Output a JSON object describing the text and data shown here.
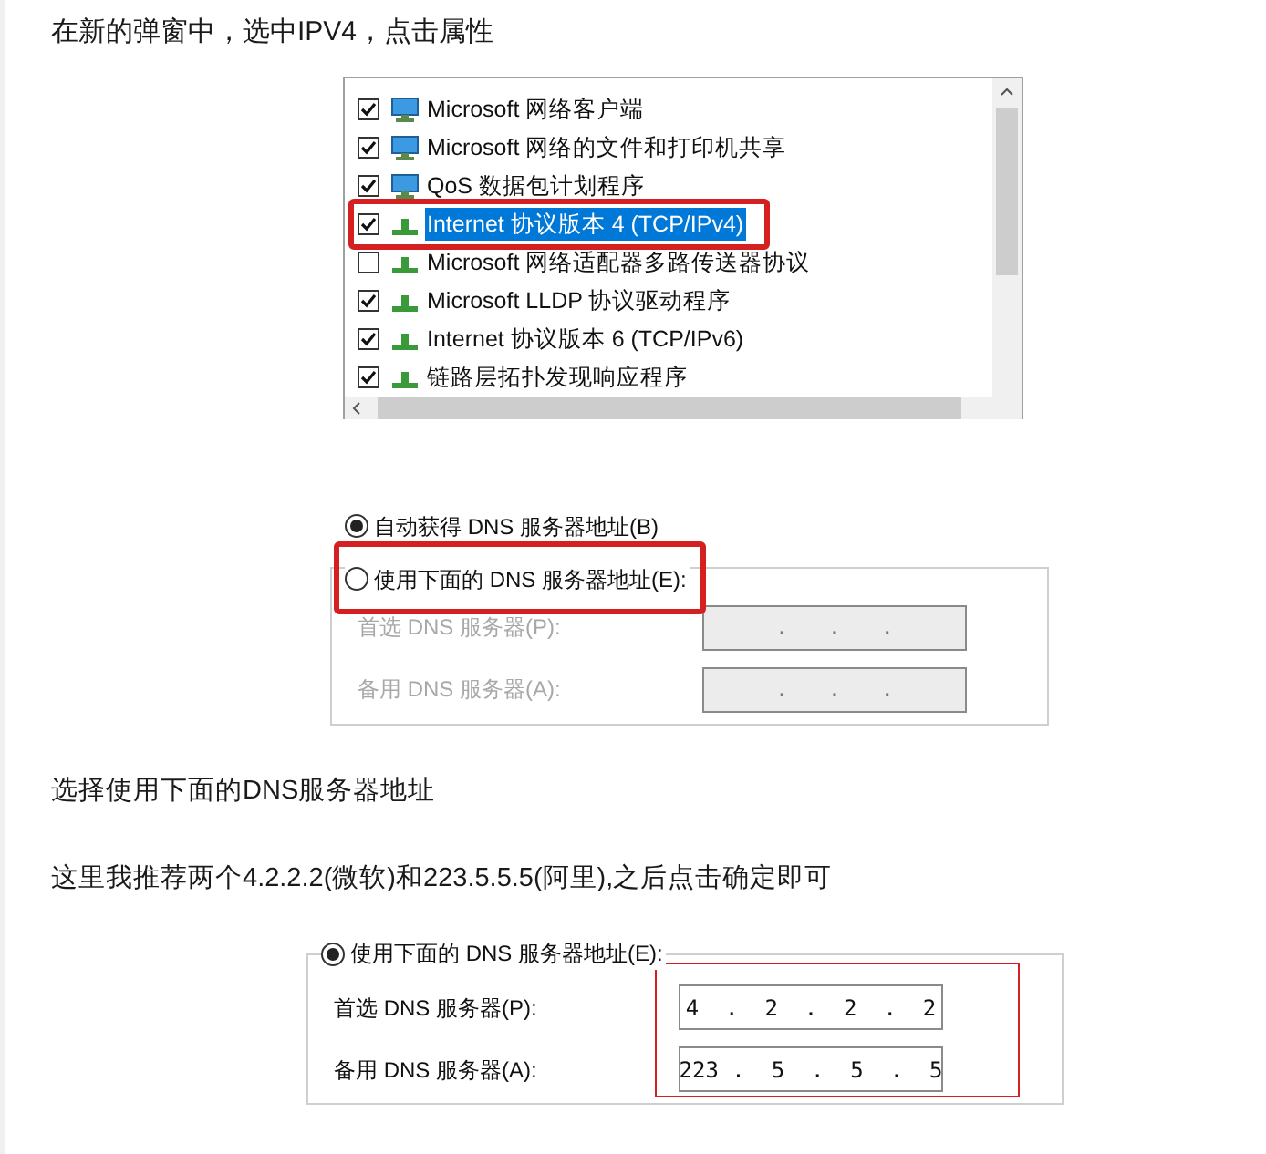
{
  "paragraphs_top": [
    "在新的弹窗中，选中IPV4，点击属性"
  ],
  "component_list": {
    "items": [
      {
        "kind": "client",
        "label": "Microsoft 网络客户端",
        "checked": true,
        "selected": false,
        "highlighted": false
      },
      {
        "kind": "client",
        "label": "Microsoft 网络的文件和打印机共享",
        "checked": true,
        "selected": false,
        "highlighted": false
      },
      {
        "kind": "client",
        "label": "QoS 数据包计划程序",
        "checked": true,
        "selected": false,
        "highlighted": false
      },
      {
        "kind": "protocol",
        "label": "Internet 协议版本 4 (TCP/IPv4)",
        "checked": true,
        "selected": true,
        "highlighted": true
      },
      {
        "kind": "protocol",
        "label": "Microsoft 网络适配器多路传送器协议",
        "checked": false,
        "selected": false,
        "highlighted": false
      },
      {
        "kind": "protocol",
        "label": "Microsoft LLDP 协议驱动程序",
        "checked": true,
        "selected": false,
        "highlighted": false
      },
      {
        "kind": "protocol",
        "label": "Internet 协议版本 6 (TCP/IPv6)",
        "checked": true,
        "selected": false,
        "highlighted": false
      },
      {
        "kind": "protocol",
        "label": "链路层拓扑发现响应程序",
        "checked": true,
        "selected": false,
        "highlighted": false
      }
    ]
  },
  "dns_before": {
    "radios": [
      {
        "label": "自动获得 DNS 服务器地址(B)",
        "selected": true,
        "highlighted": false
      },
      {
        "label": "使用下面的 DNS 服务器地址(E):",
        "selected": false,
        "highlighted": true
      }
    ],
    "fields": [
      {
        "label": "首选 DNS 服务器(P):",
        "value": ".   .   .",
        "disabled": true
      },
      {
        "label": "备用 DNS 服务器(A):",
        "value": ".   .   .",
        "disabled": true
      }
    ]
  },
  "paragraphs_middle": [
    "选择使用下面的DNS服务器地址",
    "这里我推荐两个4.2.2.2(微软)和223.5.5.5(阿里),之后点击确定即可"
  ],
  "dns_after": {
    "radios": [
      {
        "label": "使用下面的 DNS 服务器地址(E):",
        "selected": true,
        "highlighted": false
      }
    ],
    "fields_highlighted": true,
    "fields": [
      {
        "label": "首选 DNS 服务器(P):",
        "value": "4  .  2  .  2  .  2",
        "disabled": false
      },
      {
        "label": "备用 DNS 服务器(A):",
        "value": "223 .  5  .  5  .  5",
        "disabled": false
      }
    ]
  }
}
